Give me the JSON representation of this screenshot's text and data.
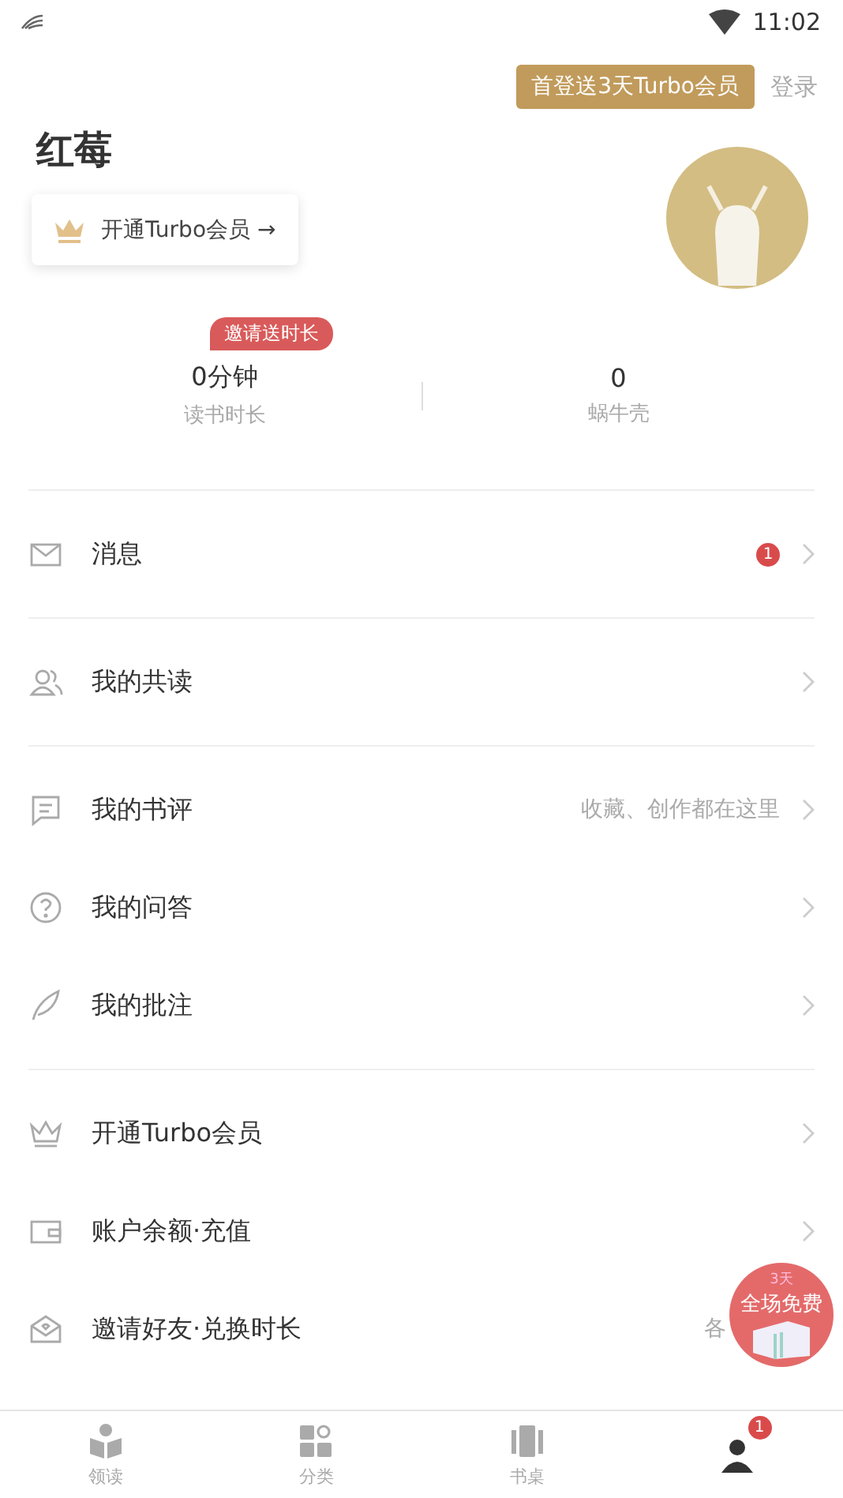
{
  "status_bar": {
    "time": "11:02"
  },
  "header": {
    "promo": "首登送3天Turbo会员",
    "login": "登录",
    "name": "红莓",
    "member_button": "开通Turbo会员 →"
  },
  "stats": [
    {
      "value": "0分钟",
      "label": "读书时长",
      "tag": "邀请送时长"
    },
    {
      "value": "0",
      "label": "蜗牛壳"
    }
  ],
  "menu_sections": [
    [
      {
        "label": "消息",
        "badge": "1"
      }
    ],
    [
      {
        "label": "我的共读"
      }
    ],
    [
      {
        "label": "我的书评",
        "hint": "收藏、创作都在这里"
      },
      {
        "label": "我的问答"
      },
      {
        "label": "我的批注"
      }
    ],
    [
      {
        "label": "开通Turbo会员"
      },
      {
        "label": "账户余额·充值"
      },
      {
        "label": "邀请好友·兑换时长",
        "hint": "各"
      }
    ]
  ],
  "floating_badge": {
    "top": "3天",
    "main": "全场免费"
  },
  "tabs": [
    {
      "label": "领读",
      "selected": false
    },
    {
      "label": "分类",
      "selected": false
    },
    {
      "label": "书桌",
      "selected": false
    },
    {
      "selected": true,
      "badge": "1"
    }
  ]
}
